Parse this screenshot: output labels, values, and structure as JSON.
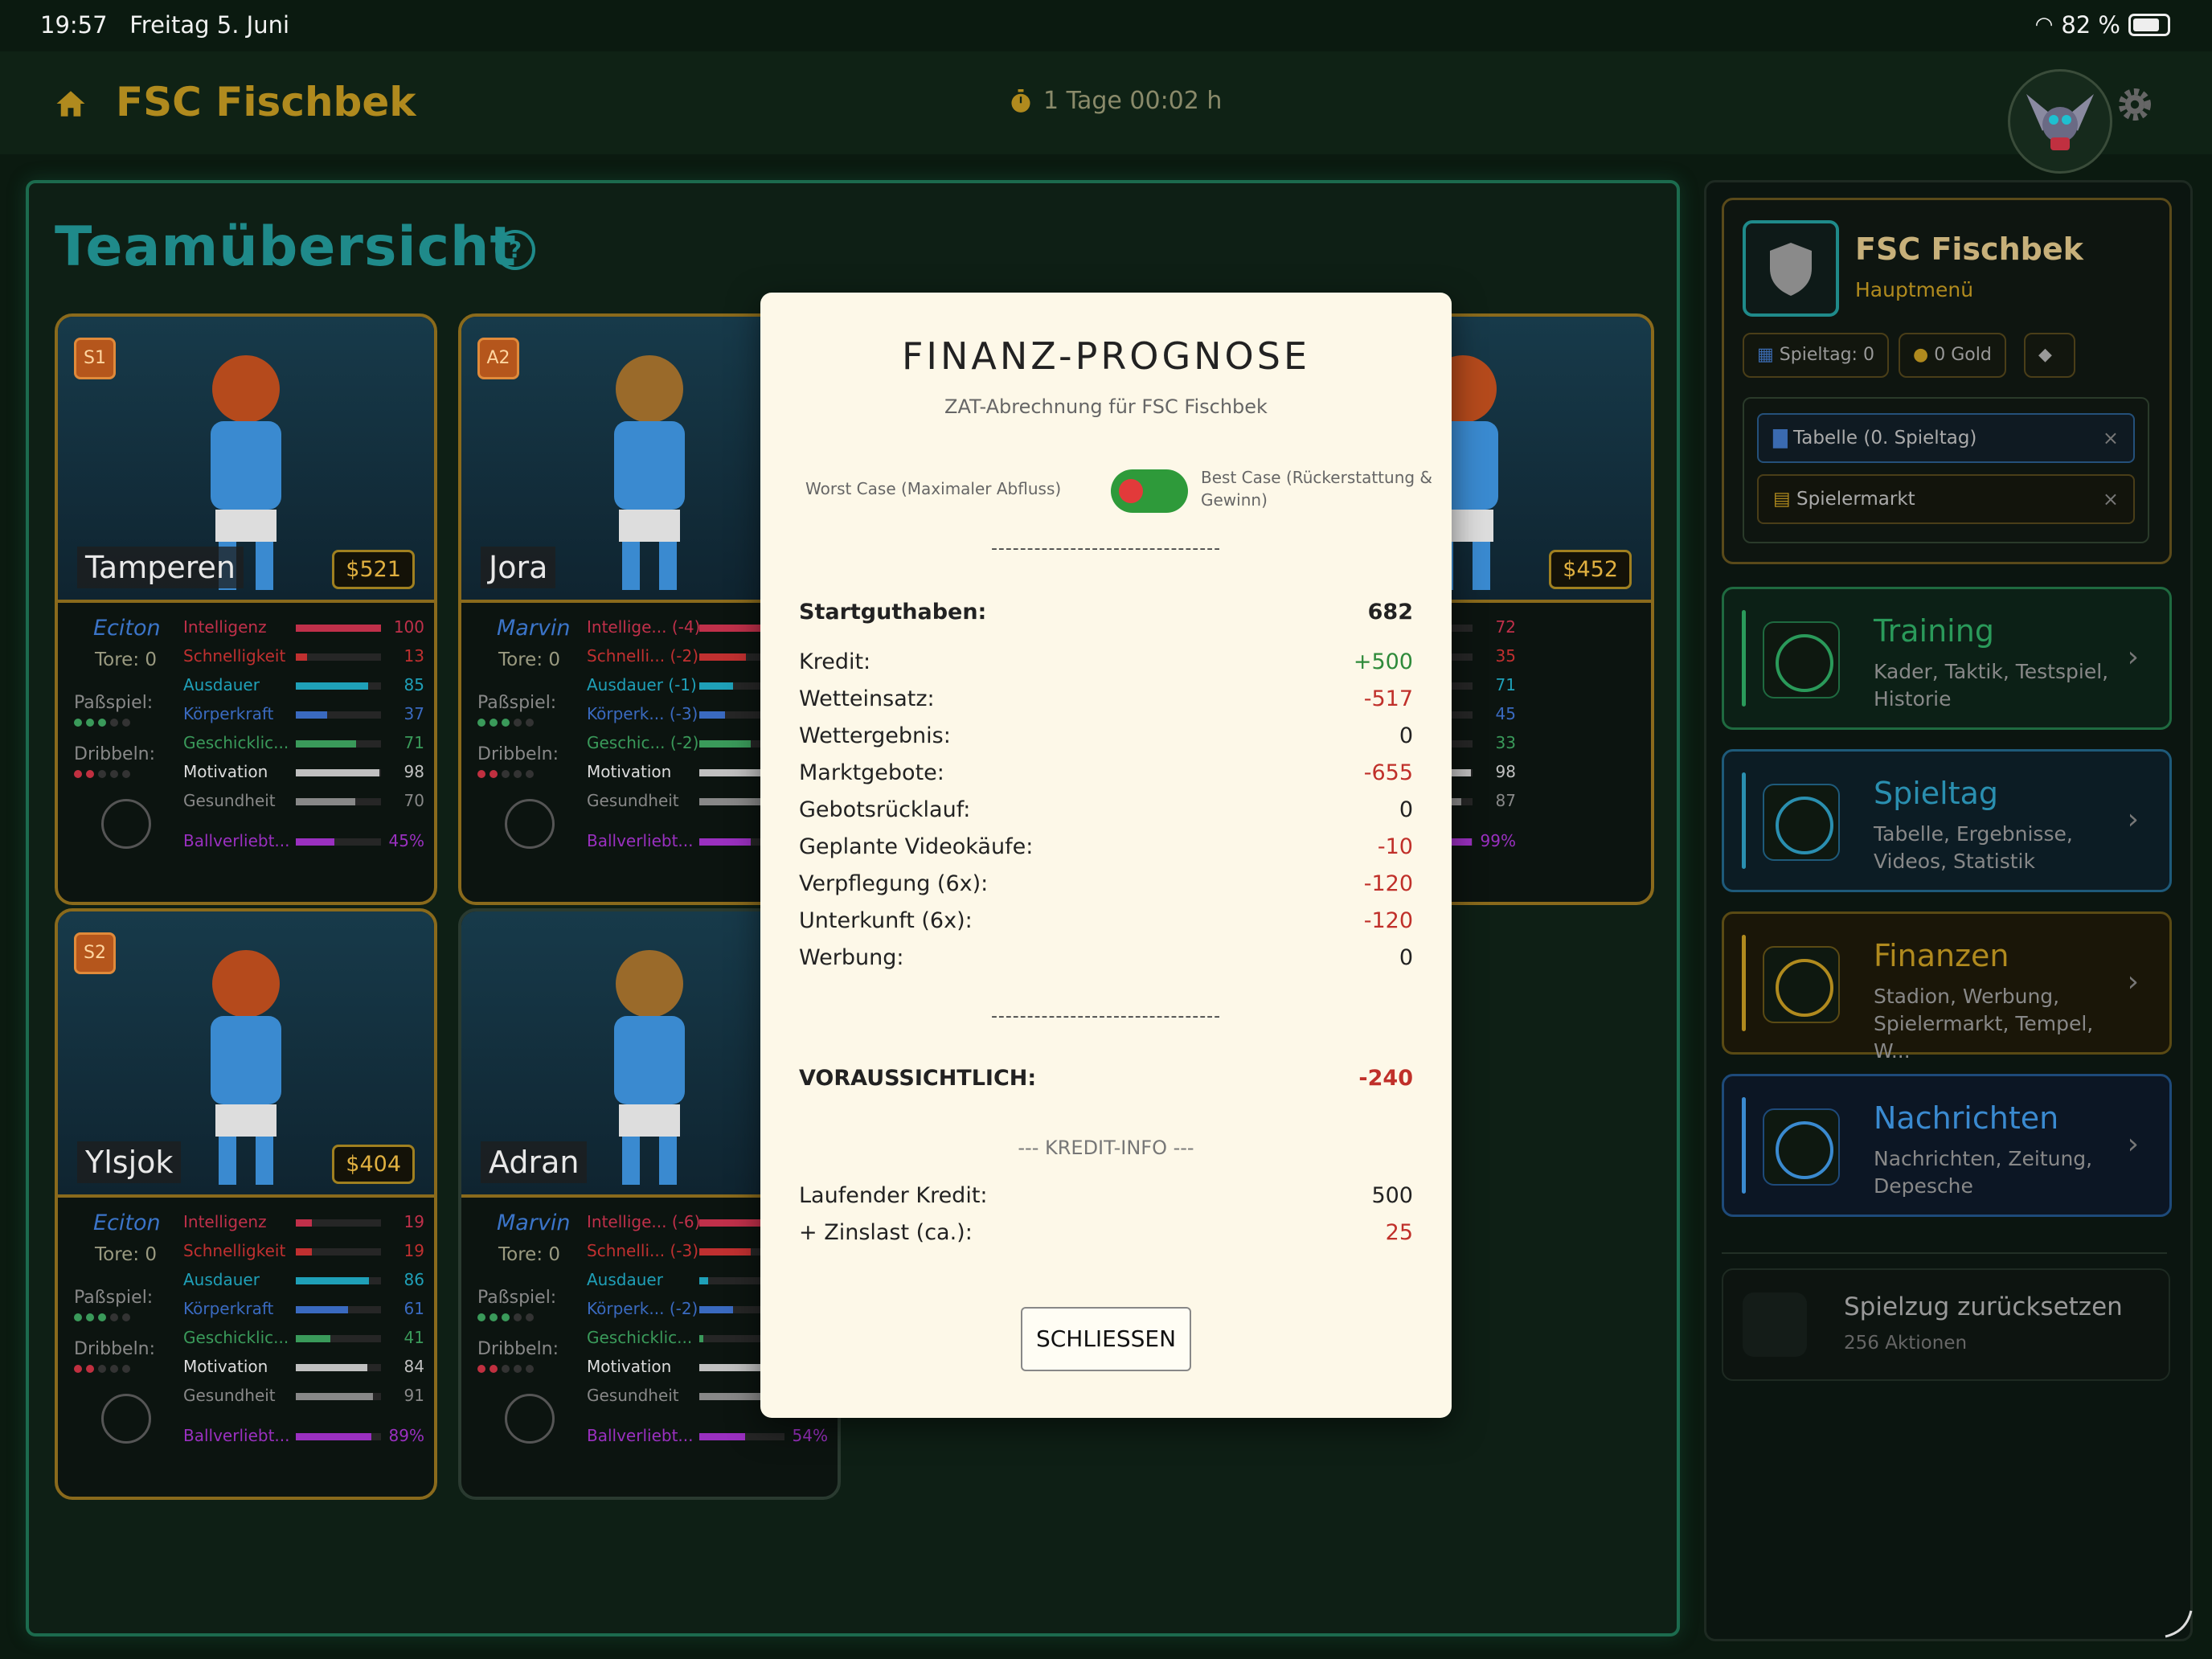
{
  "status_bar": {
    "time": "19:57",
    "date": "Freitag 5. Juni",
    "battery": "82 %"
  },
  "header": {
    "club": "FSC Fischbek",
    "timer": "1 Tage 00:02 h",
    "icons": [
      "home-icon",
      "timer-icon",
      "avatar",
      "gear-icon"
    ]
  },
  "team": {
    "title": "Teamübersicht",
    "cards": [
      {
        "badge": "S1",
        "name": "Tamperen",
        "price": "$521",
        "trainer": "Eciton",
        "tore": "Tore: 0",
        "pass": "Paßspiel:",
        "drib": "Dribbeln:",
        "stats": [
          {
            "label": "Intelligenz",
            "value": "100",
            "fill": 1.0
          },
          {
            "label": "Schnelligkeit",
            "value": "13",
            "fill": 0.13
          },
          {
            "label": "Ausdauer",
            "value": "85",
            "fill": 0.85
          },
          {
            "label": "Körperkraft",
            "value": "37",
            "fill": 0.37
          },
          {
            "label": "Geschicklic...",
            "value": "71",
            "fill": 0.71
          },
          {
            "label": "Motivation",
            "value": "98",
            "fill": 0.98
          },
          {
            "label": "Gesundheit",
            "value": "70",
            "fill": 0.7
          },
          {
            "label": "Ballverliebt...",
            "value": "45%",
            "fill": 0.45
          }
        ]
      },
      {
        "badge": "A2",
        "name": "Jora",
        "price": "",
        "trainer": "Marvin",
        "tore": "Tore: 0",
        "pass": "Paßspiel:",
        "drib": "Dribbeln:",
        "stats": [
          {
            "label": "Intellige... (-4)",
            "value": "",
            "fill": 0.9
          },
          {
            "label": "Schnelli... (-2)",
            "value": "",
            "fill": 0.55
          },
          {
            "label": "Ausdauer (-1)",
            "value": "",
            "fill": 0.4
          },
          {
            "label": "Körperk... (-3)",
            "value": "",
            "fill": 0.3
          },
          {
            "label": "Geschic... (-2)",
            "value": "",
            "fill": 0.6
          },
          {
            "label": "Motivation",
            "value": "",
            "fill": 0.9
          },
          {
            "label": "Gesundheit",
            "value": "",
            "fill": 0.9
          },
          {
            "label": "Ballverliebt...",
            "value": "",
            "fill": 0.6
          }
        ]
      },
      {
        "badge": "",
        "name": "",
        "price": "$452",
        "trainer": "",
        "tore": "",
        "pass": "",
        "drib": "",
        "stats": [
          {
            "label": "enz",
            "value": "72",
            "fill": 0.72
          },
          {
            "label": "gkeit",
            "value": "35",
            "fill": 0.35
          },
          {
            "label": "er",
            "value": "71",
            "fill": 0.71
          },
          {
            "label": "raft",
            "value": "45",
            "fill": 0.45
          },
          {
            "label": "klic...",
            "value": "33",
            "fill": 0.33
          },
          {
            "label": "ion",
            "value": "98",
            "fill": 0.98
          },
          {
            "label": "heit",
            "value": "87",
            "fill": 0.87
          },
          {
            "label": "iebt...",
            "value": "99%",
            "fill": 0.99
          }
        ]
      },
      {
        "badge": "S2",
        "name": "Ylsjok",
        "price": "$404",
        "trainer": "Eciton",
        "tore": "Tore: 0",
        "pass": "Paßspiel:",
        "drib": "Dribbeln:",
        "stats": [
          {
            "label": "Intelligenz",
            "value": "19",
            "fill": 0.19
          },
          {
            "label": "Schnelligkeit",
            "value": "19",
            "fill": 0.19
          },
          {
            "label": "Ausdauer",
            "value": "86",
            "fill": 0.86
          },
          {
            "label": "Körperkraft",
            "value": "61",
            "fill": 0.61
          },
          {
            "label": "Geschicklic...",
            "value": "41",
            "fill": 0.41
          },
          {
            "label": "Motivation",
            "value": "84",
            "fill": 0.84
          },
          {
            "label": "Gesundheit",
            "value": "91",
            "fill": 0.91
          },
          {
            "label": "Ballverliebt...",
            "value": "89%",
            "fill": 0.89
          }
        ]
      },
      {
        "badge": "",
        "name": "Adran",
        "price": "",
        "trainer": "Marvin",
        "tore": "Tore: 0",
        "pass": "Paßspiel:",
        "drib": "Dribbeln:",
        "stats": [
          {
            "label": "Intellige... (-6)",
            "value": "",
            "fill": 0.9
          },
          {
            "label": "Schnelli... (-3)",
            "value": "",
            "fill": 0.6
          },
          {
            "label": "Ausdauer",
            "value": "",
            "fill": 0.1
          },
          {
            "label": "Körperk... (-2)",
            "value": "",
            "fill": 0.4
          },
          {
            "label": "Geschicklic...",
            "value": "",
            "fill": 0.05
          },
          {
            "label": "Motivation",
            "value": "",
            "fill": 0.9
          },
          {
            "label": "Gesundheit",
            "value": "",
            "fill": 0.9
          },
          {
            "label": "Ballverliebt...",
            "value": "54%",
            "fill": 0.54
          }
        ]
      }
    ]
  },
  "modal": {
    "title": "FINANZ-PROGNOSE",
    "subtitle": "ZAT-Abrechnung für FSC Fischbek",
    "toggle_left": "Worst Case (Maximaler Abfluss)",
    "toggle_right": "Best Case (Rückerstattung & Gewinn)",
    "dashes": "--------------------------------",
    "start": {
      "label": "Startguthaben:",
      "value": "682"
    },
    "rows": [
      {
        "label": "Kredit:",
        "value": "+500",
        "tone": "pos"
      },
      {
        "label": "Wetteinsatz:",
        "value": "-517",
        "tone": "neg"
      },
      {
        "label": "Wettergebnis:",
        "value": "0",
        "tone": ""
      },
      {
        "label": "Marktgebote:",
        "value": "-655",
        "tone": "neg"
      },
      {
        "label": "Gebotsrücklauf:",
        "value": "0",
        "tone": ""
      },
      {
        "label": "Geplante Videokäufe:",
        "value": "-10",
        "tone": "neg"
      },
      {
        "label": "Verpflegung (6x):",
        "value": "-120",
        "tone": "neg"
      },
      {
        "label": "Unterkunft (6x):",
        "value": "-120",
        "tone": "neg"
      },
      {
        "label": "Werbung:",
        "value": "0",
        "tone": ""
      }
    ],
    "total": {
      "label": "VORAUSSICHTLICH:",
      "value": "-240"
    },
    "kredit_info": "--- KREDIT-INFO ---",
    "kredit_rows": [
      {
        "label": "Laufender Kredit:",
        "value": "500",
        "tone": ""
      },
      {
        "label": "+ Zinslast (ca.):",
        "value": "25",
        "tone": "neg"
      }
    ],
    "close": "SCHLIESSEN"
  },
  "sidebar": {
    "club": "FSC Fischbek",
    "sub": "Hauptmenü",
    "chip_spieltag": "Spieltag: 0",
    "chip_gold": "0 Gold",
    "pill_tabelle": "Tabelle (0. Spieltag)",
    "pill_markt": "Spielermarkt",
    "nav": [
      {
        "title": "Training",
        "desc": "Kader, Taktik, Testspiel, Historie",
        "color": "#2a9a5a",
        "bg": "#0c2016",
        "border": "#1f6a40"
      },
      {
        "title": "Spieltag",
        "desc": "Tabelle, Ergebnisse, Videos, Statistik",
        "color": "#2a8fb0",
        "bg": "#0c1c24",
        "border": "#1e5a7a"
      },
      {
        "title": "Finanzen",
        "desc": "Stadion, Werbung, Spielermarkt, Tempel, W...",
        "color": "#b08a1e",
        "bg": "#1a1608",
        "border": "#5a4a14"
      },
      {
        "title": "Nachrichten",
        "desc": "Nachrichten, Zeitung, Depesche",
        "color": "#3a8ad0",
        "bg": "#0c1624",
        "border": "#1e4a7a"
      }
    ],
    "reset_title": "Spielzug zurücksetzen",
    "reset_sub": "256 Aktionen"
  }
}
